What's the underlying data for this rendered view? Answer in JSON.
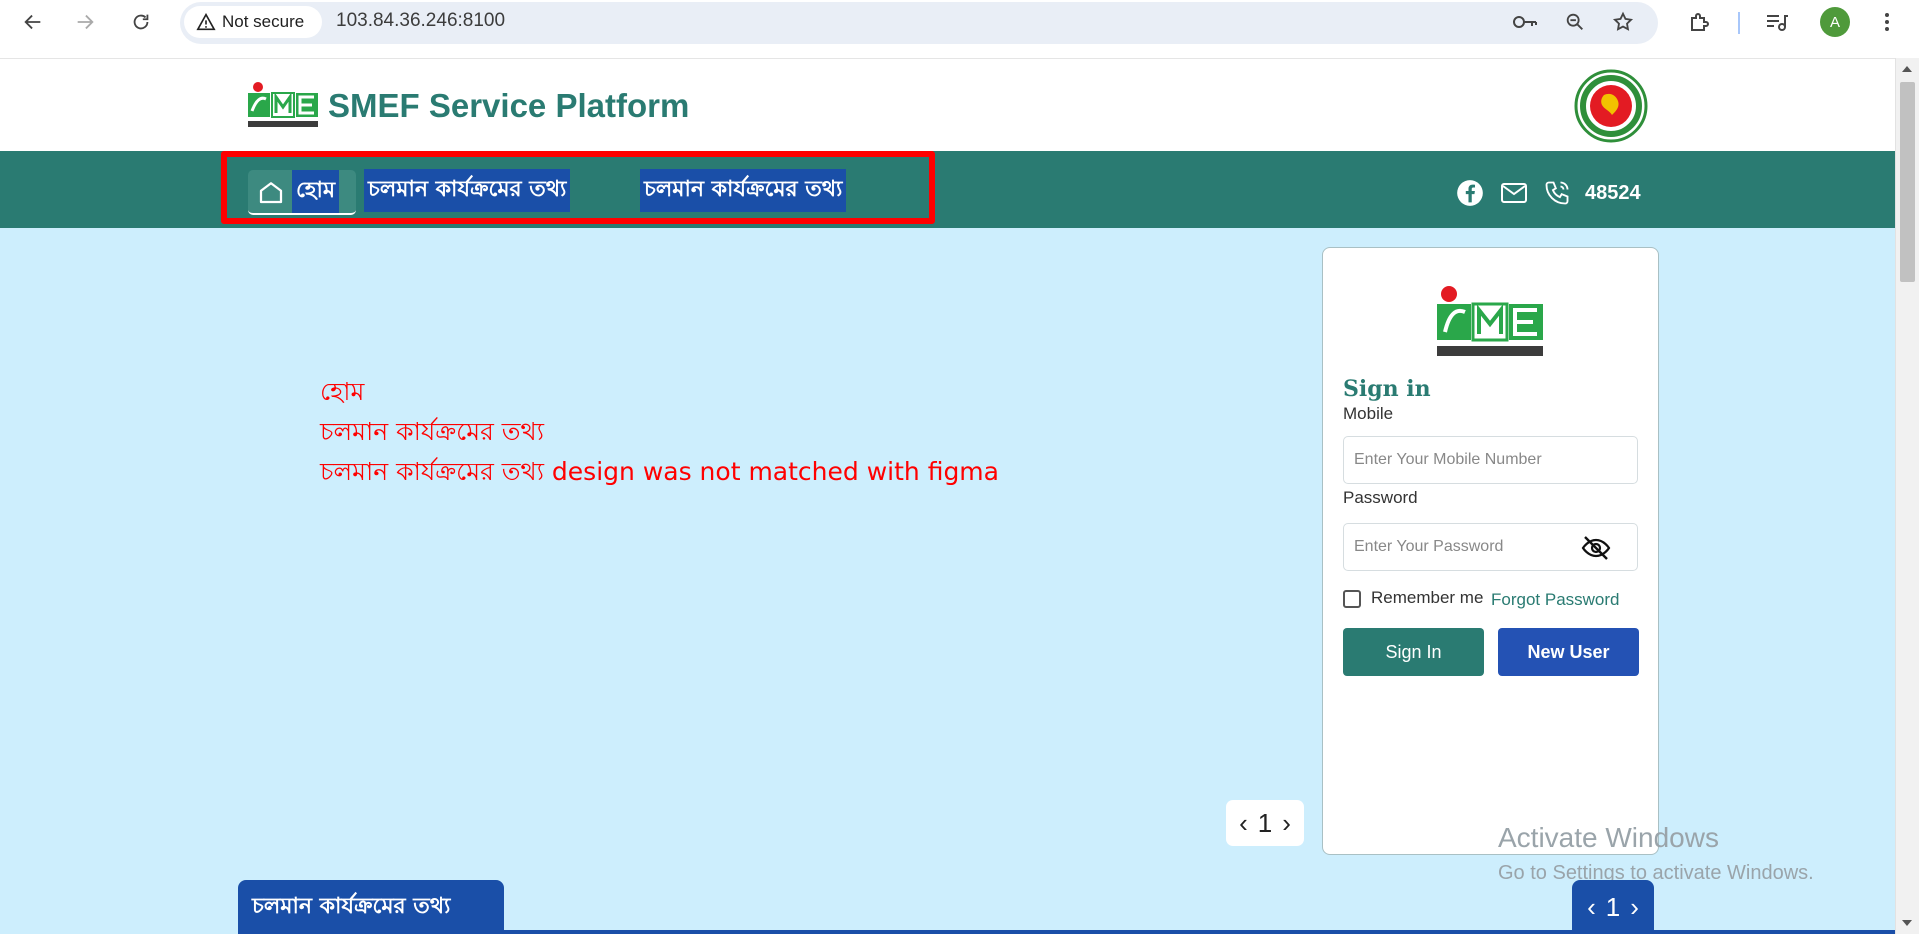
{
  "browser": {
    "security_label": "Not secure",
    "url": "103.84.36.246:8100",
    "profile_initial": "A"
  },
  "header": {
    "title": "SMEF Service Platform"
  },
  "nav": {
    "items": [
      {
        "label": "হোম",
        "icon": "home-icon"
      },
      {
        "label": "চলমান কার্যক্রমের তথ্য"
      },
      {
        "label": "চলমান কার্যক্রমের তথ্য"
      }
    ],
    "contact_number": "48524"
  },
  "annotation": {
    "lines": [
      "হোম",
      "চলমান কার্যক্রমের তথ্য",
      "চলমান কার্যক্রমের তথ্য design was not matched with figma"
    ]
  },
  "pager": {
    "prev": "‹",
    "page": "1",
    "next": "›"
  },
  "login": {
    "title": "Sign in",
    "mobile_label": "Mobile",
    "mobile_placeholder": "Enter Your Mobile Number",
    "password_label": "Password",
    "password_placeholder": "Enter Your Password",
    "remember_label": "Remember me",
    "forgot_label": "Forgot Password",
    "signin_button": "Sign In",
    "newuser_button": "New User"
  },
  "watermark": {
    "line1": "Activate Windows",
    "line2": "Go to Settings to activate Windows."
  },
  "bottom_section": {
    "tab_label": "চলমান কার্যক্রমের তথ্য",
    "pager_page": "1"
  },
  "colors": {
    "brand_green": "#2a7b72",
    "brand_blue": "#1a4fa8",
    "background": "#cdeefd",
    "annotation_red": "#ff0000"
  }
}
